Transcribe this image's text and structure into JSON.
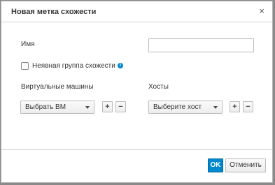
{
  "dialog": {
    "title": "Новая метка схожести",
    "close_glyph": "×"
  },
  "form": {
    "name_label": "Имя",
    "name_value": "",
    "implicit_group_label": "Неявная группа схожести",
    "implicit_group_checked": false,
    "info_glyph": "i",
    "vms_label": "Виртуальные машины",
    "vms_select_value": "Выбрать ВМ",
    "hosts_label": "Хосты",
    "hosts_select_value": "Выберите хост",
    "add_glyph": "+",
    "remove_glyph": "−"
  },
  "footer": {
    "ok_label": "OK",
    "cancel_label": "Отменить"
  },
  "colors": {
    "primary": "#0088ce",
    "info": "#0088ce"
  }
}
